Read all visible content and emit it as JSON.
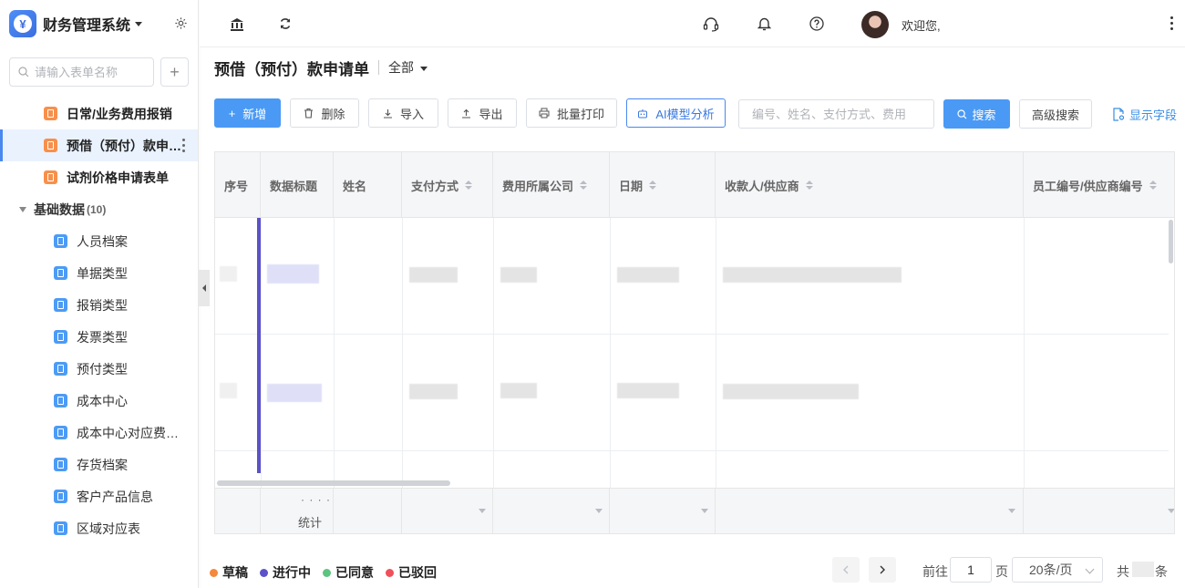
{
  "sidebar": {
    "app_title": "财务管理系统",
    "search_placeholder": "请输入表单名称",
    "add_label": "+",
    "forms": [
      {
        "label": "日常/业务费用报销"
      },
      {
        "label": "预借（预付）款申请单"
      },
      {
        "label": "试剂价格申请表单"
      }
    ],
    "group": {
      "label": "基础数据",
      "count": "(10)"
    },
    "group_items": [
      {
        "label": "人员档案"
      },
      {
        "label": "单据类型"
      },
      {
        "label": "报销类型"
      },
      {
        "label": "发票类型"
      },
      {
        "label": "预付类型"
      },
      {
        "label": "成本中心"
      },
      {
        "label": "成本中心对应费用科目"
      },
      {
        "label": "存货档案"
      },
      {
        "label": "客户产品信息"
      },
      {
        "label": "区域对应表"
      }
    ]
  },
  "header": {
    "welcome": "欢迎您,"
  },
  "page": {
    "title": "预借（预付）款申请单",
    "filter": "全部"
  },
  "toolbar": {
    "new": "新增",
    "delete": "删除",
    "import": "导入",
    "export": "导出",
    "batch_print": "批量打印",
    "ai_analysis": "AI模型分析",
    "search_placeholder": "编号、姓名、支付方式、费用",
    "search": "搜索",
    "advanced_search": "高级搜索",
    "show_fields": "显示字段"
  },
  "table": {
    "columns": [
      "序号",
      "数据标题",
      "姓名",
      "支付方式",
      "费用所属公司",
      "日期",
      "收款人/供应商",
      "员工编号/供应商编号"
    ],
    "footer_label": "统计",
    "footer_dots": "· · · ·"
  },
  "legend": [
    {
      "label": "草稿",
      "color": "#f5883a"
    },
    {
      "label": "进行中",
      "color": "#5b52c9"
    },
    {
      "label": "已同意",
      "color": "#5cc47e"
    },
    {
      "label": "已驳回",
      "color": "#f0505a"
    }
  ],
  "pagination": {
    "goto_prefix": "前往",
    "page": "1",
    "page_suffix": "页",
    "page_size": "20条/页",
    "total_prefix": "共",
    "total_suffix": "条"
  }
}
